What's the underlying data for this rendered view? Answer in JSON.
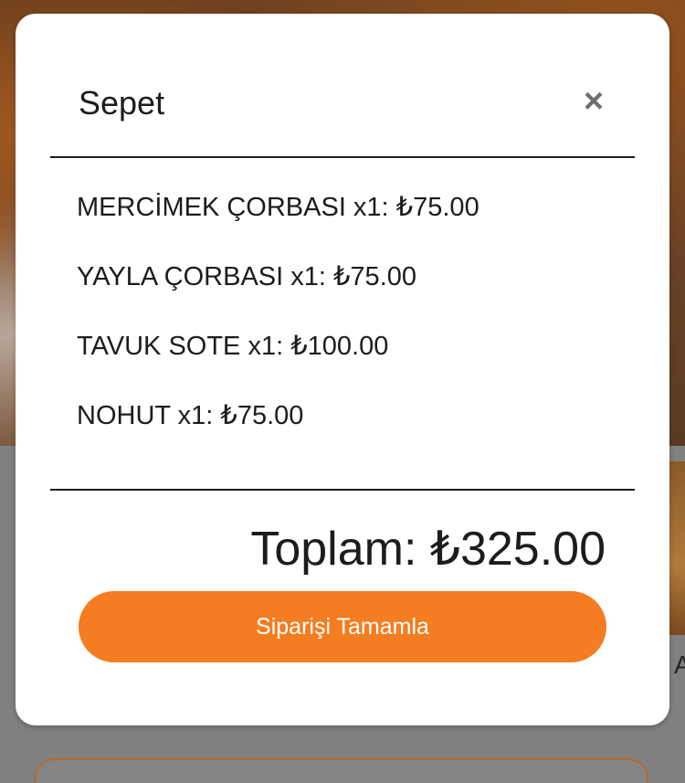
{
  "cart": {
    "title": "Sepet",
    "close_icon": "×",
    "items": [
      {
        "text": "MERCİMEK ÇORBASI x1: ₺75.00"
      },
      {
        "text": "YAYLA ÇORBASI x1: ₺75.00"
      },
      {
        "text": "TAVUK SOTE x1: ₺100.00"
      },
      {
        "text": "NOHUT x1: ₺75.00"
      }
    ],
    "total": "Toplam: ₺325.00",
    "checkout_label": "Siparişi Tamamla"
  },
  "background": {
    "partial_letter": "A"
  },
  "colors": {
    "accent": "#f37d20",
    "text": "#1c1c1e",
    "close_icon": "#6e6e6e",
    "overlay": "#808080"
  }
}
